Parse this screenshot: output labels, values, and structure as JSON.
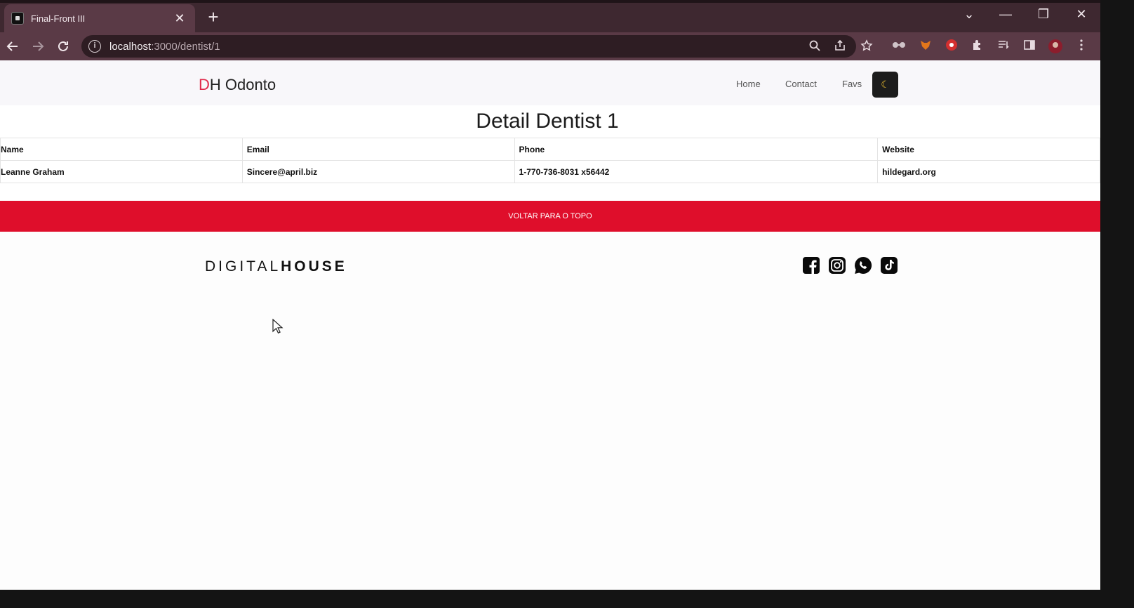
{
  "browser": {
    "tab_title": "Final-Front III",
    "tab_close": "✕",
    "new_tab": "+",
    "url_host": "localhost",
    "url_path": ":3000/dentist/1",
    "window_controls": [
      "⌄",
      "—",
      "❐",
      "✕"
    ]
  },
  "navbar": {
    "brand_first": "D",
    "brand_rest": "H Odonto",
    "links": [
      "Home",
      "Contact",
      "Favs"
    ],
    "theme_icon": "moon-icon",
    "theme_glyph": "☾"
  },
  "detail": {
    "title": "Detail Dentist 1",
    "headers": [
      "Name",
      "Email",
      "Phone",
      "Website"
    ],
    "row": [
      "Leanne Graham",
      "Sincere@april.biz",
      "1-770-736-8031 x56442",
      "hildegard.org"
    ]
  },
  "back_to_top": "VOLTAR PARA O TOPO",
  "footer": {
    "logo_light": "DIGITAL",
    "logo_bold": "HOUSE",
    "social": [
      "facebook-icon",
      "instagram-icon",
      "whatsapp-icon",
      "tiktok-icon"
    ]
  },
  "colors": {
    "accent": "#df0e2b",
    "brand_d": "#e0284a",
    "tab_bar": "#3e2830",
    "toolbar": "#5a3a46"
  }
}
